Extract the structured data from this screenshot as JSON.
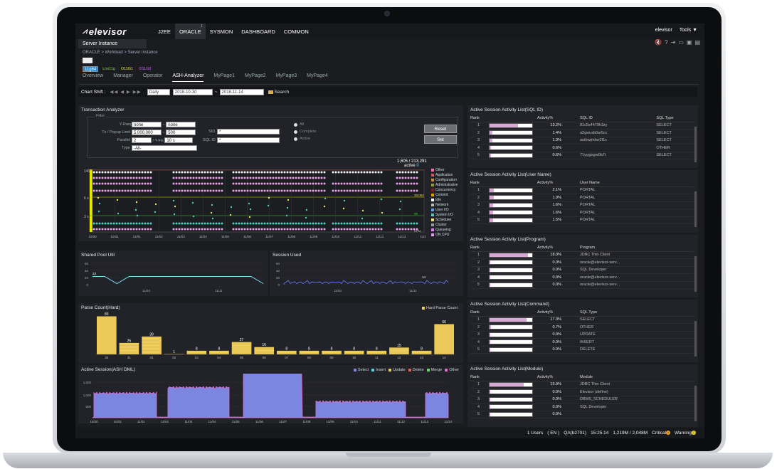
{
  "app": {
    "logo": "elevisor"
  },
  "nav": [
    {
      "label": "J2EE",
      "count": ""
    },
    {
      "label": "ORACLE",
      "count": "1"
    },
    {
      "label": "SYSMON",
      "count": ""
    },
    {
      "label": "DASHBOARD",
      "count": ""
    },
    {
      "label": "COMMON",
      "count": ""
    }
  ],
  "topright": {
    "user": "elevisor",
    "tools": "Tools ▼"
  },
  "server_tab": "Server Instance",
  "breadcrumb": "ORACLE > Workload > Server Instance",
  "instances": [
    "11g64",
    "Lnx11g",
    "O11G1",
    "O11G2"
  ],
  "subtabs": [
    "Overview",
    "Manager",
    "Operator",
    "ASH-Analyzer",
    "MyPage1",
    "MyPage2",
    "MyPage3",
    "MyPage4"
  ],
  "chart_shift": {
    "label": "Chart Shift :",
    "period": "Daily",
    "from": "2018-10-30",
    "tilde": "~",
    "to": "2018-11-14",
    "search": "Search"
  },
  "transaction_analyzer": {
    "title": "Transaction Analyzer",
    "filter": "Filter",
    "yrange_label": "Y-Rang(ms)",
    "yrange_from": "none",
    "yrange_to": "none",
    "tx_label": "Tx / Popup Limit",
    "tx_value": "5,000,000",
    "popup_value": "500",
    "parallel_label": "Parallel",
    "parallel_value": "2",
    "yfix_label": "/ Y-Fix",
    "yfix_value": "10 s",
    "type_label": "Type",
    "type_value": "-All-",
    "sid_label": "SID",
    "sid_value": "*",
    "sqlid_label": "SQL ID",
    "sqlid_value": "*",
    "radio": [
      "All",
      "Complete",
      "Active"
    ],
    "reset": "Reset",
    "set": "Set",
    "count": "1,605 / 213,291",
    "active_label": "active",
    "active_value": "0",
    "y_ticks": [
      "140",
      "6 s",
      "3 s"
    ],
    "right_marks": [
      "20,062",
      "99",
      "CPU"
    ],
    "x_ticks": [
      "10/30",
      "10/31",
      "11/01",
      "11/02",
      "11/03",
      "11/04",
      "11/05",
      "11/06",
      "11/07",
      "11/08",
      "11/09",
      "11/10",
      "11/11",
      "11/12",
      "11/13",
      "11/14"
    ]
  },
  "wait_legend": [
    {
      "name": "Other",
      "color": "#ff69b4"
    },
    {
      "name": "Application",
      "color": "#e05050"
    },
    {
      "name": "Configuration",
      "color": "#d28a2a"
    },
    {
      "name": "Administrative",
      "color": "#9a9a30"
    },
    {
      "name": "Concurrency",
      "color": "#8b1a1a"
    },
    {
      "name": "Commit",
      "color": "#e0a000"
    },
    {
      "name": "Idle",
      "color": "#ffffff"
    },
    {
      "name": "Network",
      "color": "#bbbbbb"
    },
    {
      "name": "User I/O",
      "color": "#5aa0ff"
    },
    {
      "name": "System I/O",
      "color": "#4cd0c0"
    },
    {
      "name": "Scheduler",
      "color": "#f0e060"
    },
    {
      "name": "Cluster",
      "color": "#999999"
    },
    {
      "name": "Queueing",
      "color": "#e080ff"
    },
    {
      "name": "ON CPU",
      "color": "#e6a0e6"
    }
  ],
  "shared_pool": {
    "title": "Shared Pool Util",
    "y_ticks": [
      "60",
      "40",
      "20",
      "0"
    ],
    "x_ticks": [
      "11/04",
      "11/11"
    ],
    "marker": "23",
    "values": [
      23,
      23,
      3,
      23,
      23,
      23,
      23,
      23,
      23,
      23,
      23,
      23,
      23,
      23,
      3
    ]
  },
  "session_used": {
    "title": "Session Used",
    "y_ticks": [
      "60",
      "40",
      "20",
      "0"
    ],
    "x_ticks": [
      "11/04",
      "11/11"
    ],
    "marker": "14"
  },
  "parse_count": {
    "title": "Parse Count(Hard)",
    "legend": "Hard Parse Count",
    "chart_data": {
      "type": "bar",
      "categories": [
        "30",
        "31",
        "01",
        "02",
        "03",
        "04",
        "05",
        "06",
        "07",
        "08",
        "09",
        "10",
        "11",
        "12",
        "13",
        "14"
      ],
      "values": [
        83,
        25,
        39,
        1,
        8,
        8,
        27,
        16,
        8,
        8,
        8,
        8,
        8,
        15,
        8,
        66
      ],
      "ylim": [
        0,
        90
      ]
    }
  },
  "active_session": {
    "title": "Active Session(ASH DML)",
    "legend": [
      {
        "name": "Select",
        "color": "#7b86e0"
      },
      {
        "name": "Insert",
        "color": "#5cd0d8"
      },
      {
        "name": "Update",
        "color": "#e0d060"
      },
      {
        "name": "Delete",
        "color": "#e06060"
      },
      {
        "name": "Merge",
        "color": "#70d070"
      },
      {
        "name": "Other",
        "color": "#e070d0"
      }
    ],
    "y_ticks": [
      "1,500",
      "1,000",
      "500"
    ],
    "x_ticks": [
      "10/30",
      "10/31",
      "11/01",
      "11/02",
      "11/03",
      "11/04",
      "11/05",
      "11/06",
      "11/07",
      "11/08",
      "11/09",
      "11/10",
      "11/11",
      "11/12",
      "11/13",
      "11/14"
    ]
  },
  "right_panels": [
    {
      "title": "Active Session Activity List(SQL ID)",
      "col": "SQL ID",
      "col2": "SQL Type",
      "rows": [
        {
          "rank": "1",
          "pct": "13.2%",
          "v": 13.2,
          "name": "81c5s4479h3zy",
          "extra": "SELECT"
        },
        {
          "rank": "2",
          "pct": "1.4%",
          "v": 1.4,
          "name": "a2gwusb0ar5cc",
          "extra": "SELECT"
        },
        {
          "rank": "3",
          "pct": "1.3%",
          "v": 1.3,
          "name": "autbwjmbw2f1x",
          "extra": "SELECT"
        },
        {
          "rank": "4",
          "pct": "0.6%",
          "v": 0.6,
          "name": "",
          "extra": "OTHER"
        },
        {
          "rank": "5",
          "pct": "0.6%",
          "v": 0.6,
          "name": "71yygjxgw0b7t",
          "extra": "SELECT"
        }
      ]
    },
    {
      "title": "Active Session Activity List(User Name)",
      "col": "User Name",
      "col2": "",
      "rows": [
        {
          "rank": "1",
          "pct": "2.1%",
          "v": 2.1,
          "name": "PORTAL",
          "extra": ""
        },
        {
          "rank": "2",
          "pct": "1.9%",
          "v": 1.9,
          "name": "PORTAL",
          "extra": ""
        },
        {
          "rank": "3",
          "pct": "1.6%",
          "v": 1.6,
          "name": "PORTAL",
          "extra": ""
        },
        {
          "rank": "4",
          "pct": "1.6%",
          "v": 1.6,
          "name": "PORTAL",
          "extra": ""
        },
        {
          "rank": "5",
          "pct": "1.5%",
          "v": 1.5,
          "name": "PORTAL",
          "extra": ""
        }
      ]
    },
    {
      "title": "Active Session Activity List(Program)",
      "col": "Program",
      "col2": "",
      "rows": [
        {
          "rank": "1",
          "pct": "18.0%",
          "v": 18.0,
          "name": "JDBC Thin Client",
          "extra": ""
        },
        {
          "rank": "2",
          "pct": "0.0%",
          "v": 0.0,
          "name": "oracle@elevisor-serv...",
          "extra": ""
        },
        {
          "rank": "3",
          "pct": "0.0%",
          "v": 0.0,
          "name": "SQL Developer",
          "extra": ""
        },
        {
          "rank": "4",
          "pct": "0.0%",
          "v": 0.0,
          "name": "oracle@elevisor-serv...",
          "extra": ""
        },
        {
          "rank": "5",
          "pct": "0.0%",
          "v": 0.0,
          "name": "oracle@elevisor-serv...",
          "extra": ""
        }
      ]
    },
    {
      "title": "Active Session Activity List(Command)",
      "col": "SQL Type",
      "col2": "",
      "rows": [
        {
          "rank": "1",
          "pct": "17.3%",
          "v": 17.3,
          "name": "SELECT",
          "extra": ""
        },
        {
          "rank": "2",
          "pct": "0.7%",
          "v": 0.7,
          "name": "OTHER",
          "extra": ""
        },
        {
          "rank": "3",
          "pct": "0.0%",
          "v": 0.0,
          "name": "UPDATE",
          "extra": ""
        },
        {
          "rank": "4",
          "pct": "0.0%",
          "v": 0.0,
          "name": "INSERT",
          "extra": ""
        },
        {
          "rank": "5",
          "pct": "0.0%",
          "v": 0.0,
          "name": "DELETE",
          "extra": ""
        }
      ]
    },
    {
      "title": "Active Session Activity List(Module)",
      "col": "Module",
      "col2": "",
      "rows": [
        {
          "rank": "1",
          "pct": "15.9%",
          "v": 15.9,
          "name": "JDBC Thin Client",
          "extra": ""
        },
        {
          "rank": "2",
          "pct": "0.0%",
          "v": 0.0,
          "name": "Elevisor (define)",
          "extra": ""
        },
        {
          "rank": "3",
          "pct": "0.0%",
          "v": 0.0,
          "name": "DBMS_SCHEDULER",
          "extra": ""
        },
        {
          "rank": "4",
          "pct": "0.0%",
          "v": 0.0,
          "name": "SQL Developer",
          "extra": ""
        },
        {
          "rank": "5",
          "pct": "0.0%",
          "v": 0.0,
          "name": "",
          "extra": ""
        }
      ]
    }
  ],
  "table_headers": {
    "rank": "Rank",
    "activity": "Activity%"
  },
  "status": {
    "users": "1 Users",
    "lang": "( EN )",
    "qa": "QA(b2701)",
    "time": "15:25:14",
    "mem": "1,219M / 2,048M",
    "critical": "Critical",
    "critical_count": "1",
    "warning": "Warning",
    "warning_count": "1"
  }
}
